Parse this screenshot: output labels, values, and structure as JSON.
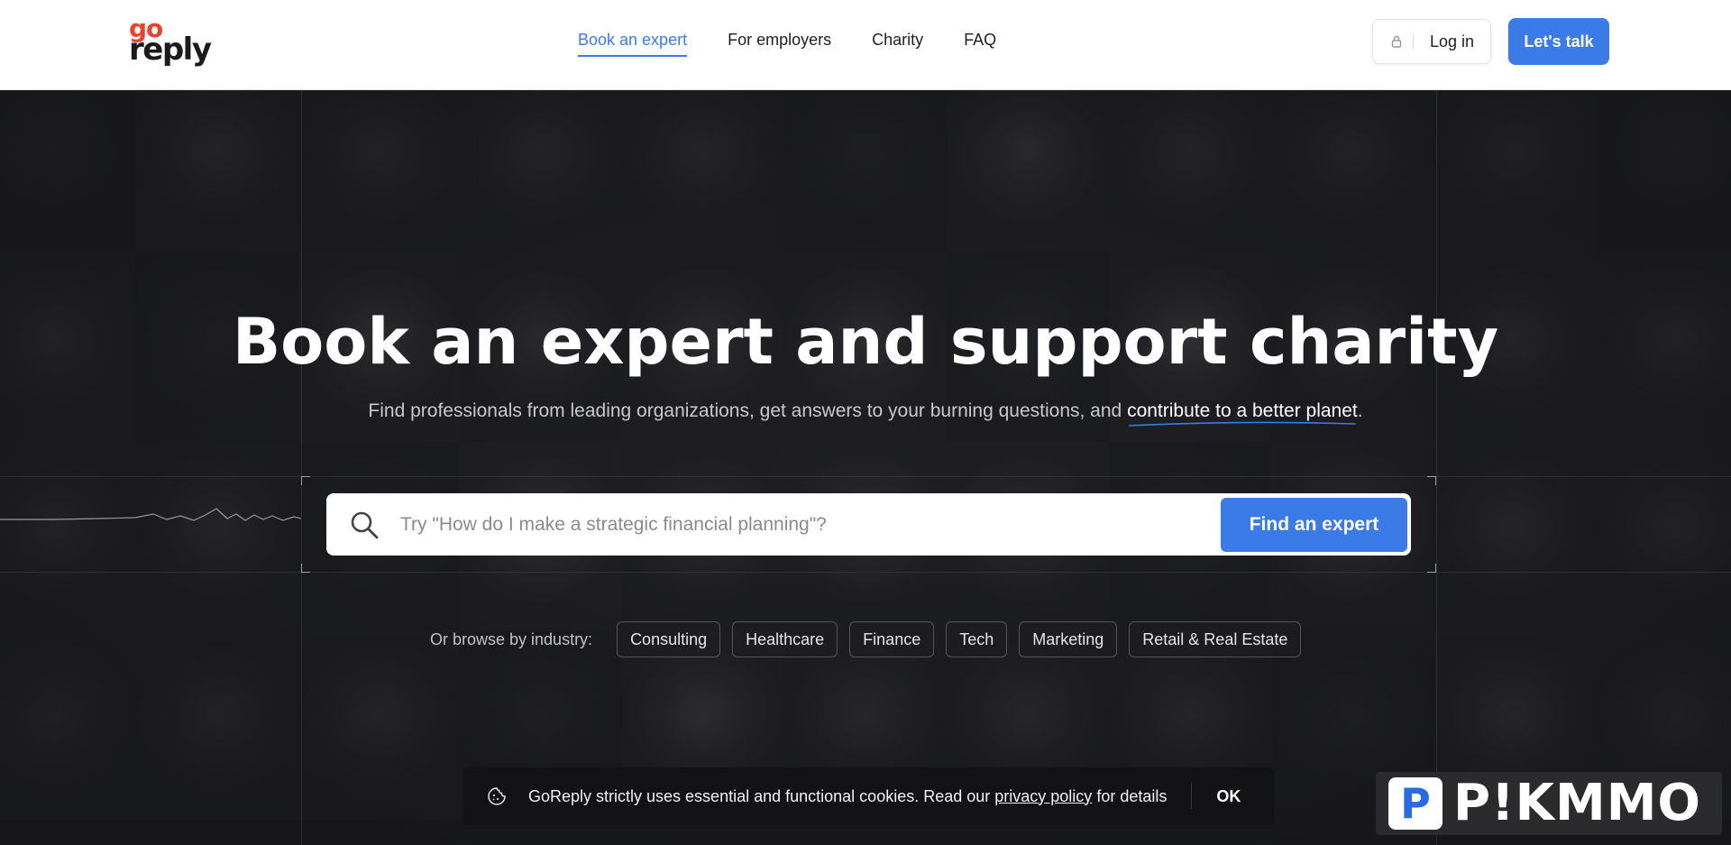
{
  "header": {
    "logo_top": "go",
    "logo_bottom": "reply",
    "nav": [
      {
        "label": "Book an expert",
        "active": true
      },
      {
        "label": "For employers",
        "active": false
      },
      {
        "label": "Charity",
        "active": false
      },
      {
        "label": "FAQ",
        "active": false
      }
    ],
    "login_label": "Log in",
    "cta_label": "Let's talk"
  },
  "hero": {
    "title": "Book an expert and support charity",
    "subtitle_pre": "Find professionals from leading organizations, get answers to your burning questions, and",
    "subtitle_highlight": "contribute to a better planet",
    "subtitle_post": "."
  },
  "search": {
    "placeholder": "Try \"How do I make a strategic financial planning\"?",
    "button_label": "Find an expert"
  },
  "browse": {
    "label": "Or browse by industry:",
    "industries": [
      "Consulting",
      "Healthcare",
      "Finance",
      "Tech",
      "Marketing",
      "Retail & Real Estate"
    ]
  },
  "cookie": {
    "text_pre": "GoReply strictly uses essential and functional cookies. Read our",
    "link_label": "privacy policy",
    "text_post": "for details",
    "ok_label": "OK"
  },
  "watermark": {
    "badge_letter": "P",
    "text": "P!KMMO"
  },
  "colors": {
    "accent": "#3b7be8",
    "logo_red": "#e8432e",
    "hero_bg": "#1e1f23"
  }
}
